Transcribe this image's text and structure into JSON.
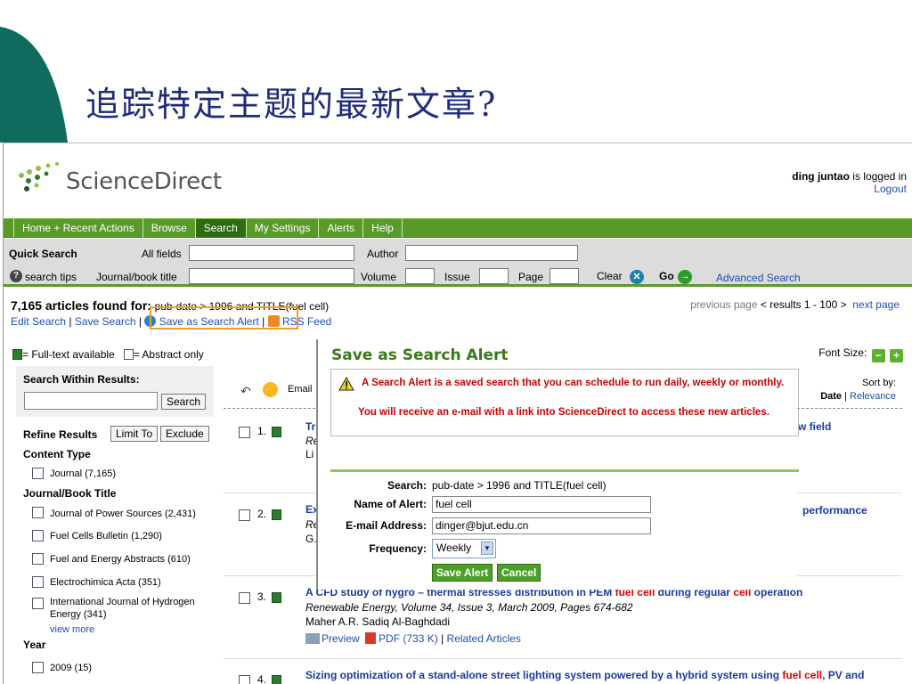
{
  "slide": {
    "title": "追踪特定主题的最新文章?"
  },
  "header": {
    "brand": "ScienceDirect",
    "user": "ding juntao",
    "logged_in_suffix": "is logged in",
    "logout": "Logout"
  },
  "nav": [
    "Home + Recent Actions",
    "Browse",
    "Search",
    "My Settings",
    "Alerts",
    "Help"
  ],
  "quick_search": {
    "title": "Quick Search",
    "all_fields": "All fields",
    "author": "Author",
    "search_tips": "search tips",
    "journal_title": "Journal/book title",
    "volume": "Volume",
    "issue": "Issue",
    "page": "Page",
    "clear": "Clear",
    "go": "Go",
    "advanced": "Advanced Search"
  },
  "results": {
    "count": "7,165 articles found for:",
    "query_struck": "pub-date > 1996 and TI",
    "query_rest": "TLE(fuel cell)",
    "edit_search": "Edit Search",
    "save_search": "Save Search",
    "save_alert": "Save as Search Alert",
    "rss": "RSS Feed",
    "pager_prev": "previous page",
    "pager_range": "< results 1 - 100 >",
    "pager_next": "next page",
    "legend_full": "= Full-text available",
    "legend_abstract": "= Abstract only",
    "font_size": "Font Size:",
    "font_minus": "−",
    "font_plus": "+",
    "email": "Email",
    "sort_by": "Sort by:",
    "sort_date": "Date",
    "sort_relevance": "Relevance"
  },
  "sidebar": {
    "search_within": "Search Within Results:",
    "search_btn": "Search",
    "refine": "Refine Results",
    "limit_to": "Limit To",
    "exclude": "Exclude",
    "content_type": "Content Type",
    "content_items": [
      "Journal (7,165)"
    ],
    "journal_title": "Journal/Book Title",
    "journal_items": [
      "Journal of Power Sources (2,431)",
      "Fuel Cells Bulletin (1,290)",
      "Fuel and Energy Abstracts (610)",
      "Electrochimica Acta (351)",
      "International Journal of Hydrogen Energy (341)"
    ],
    "view_more": "view more",
    "year": "Year",
    "year_items": [
      "2009 (15)"
    ]
  },
  "articles": [
    {
      "num": "1.",
      "title_part": "Tr",
      "source_part": "Re",
      "author_part": "Li",
      "tail": "w field"
    },
    {
      "num": "2.",
      "title_part": "Ex",
      "source_part": "Re",
      "author_part": "G.",
      "tail": "performance"
    },
    {
      "num": "3.",
      "title_a": "A CFD study of hygro – thermal stresses distribution in PEM ",
      "title_hl1": "fuel cell",
      "title_b": " during regular ",
      "title_hl2": "cell",
      "title_c": " operation",
      "source": "Renewable Energy, Volume 34, Issue 3, March 2009, Pages 674-682",
      "authors": "Maher A.R. Sadiq Al-Baghdadi",
      "preview": "Preview",
      "pdf": "PDF (733 K)",
      "related": "Related Articles"
    },
    {
      "num": "4.",
      "title_a": "Sizing optimization of a stand-alone street lighting system powered by a hybrid system using ",
      "title_hl1": "fuel cell",
      "title_b": ", PV and"
    }
  ],
  "modal": {
    "title": "Save as Search Alert",
    "warning_1": "A Search Alert is a saved search that you can schedule to run daily, weekly or monthly.",
    "warning_2": "You will receive an e-mail with a link into ScienceDirect to access these new articles.",
    "search_label": "Search:",
    "search_value": "pub-date > 1996 and TITLE(fuel cell)",
    "name_label": "Name of Alert:",
    "name_value": "fuel cell",
    "email_label": "E-mail Address:",
    "email_value": "dinger@bjut.edu.cn",
    "freq_label": "Frequency:",
    "freq_value": "Weekly",
    "save_btn": "Save Alert",
    "cancel_btn": "Cancel"
  },
  "colors": {
    "brand_green": "#5a9a2a",
    "title_blue": "#1f2d7a",
    "deco_teal": "#0e6b5e",
    "link_blue": "#1f4fb0",
    "alert_red": "#cc0000"
  }
}
